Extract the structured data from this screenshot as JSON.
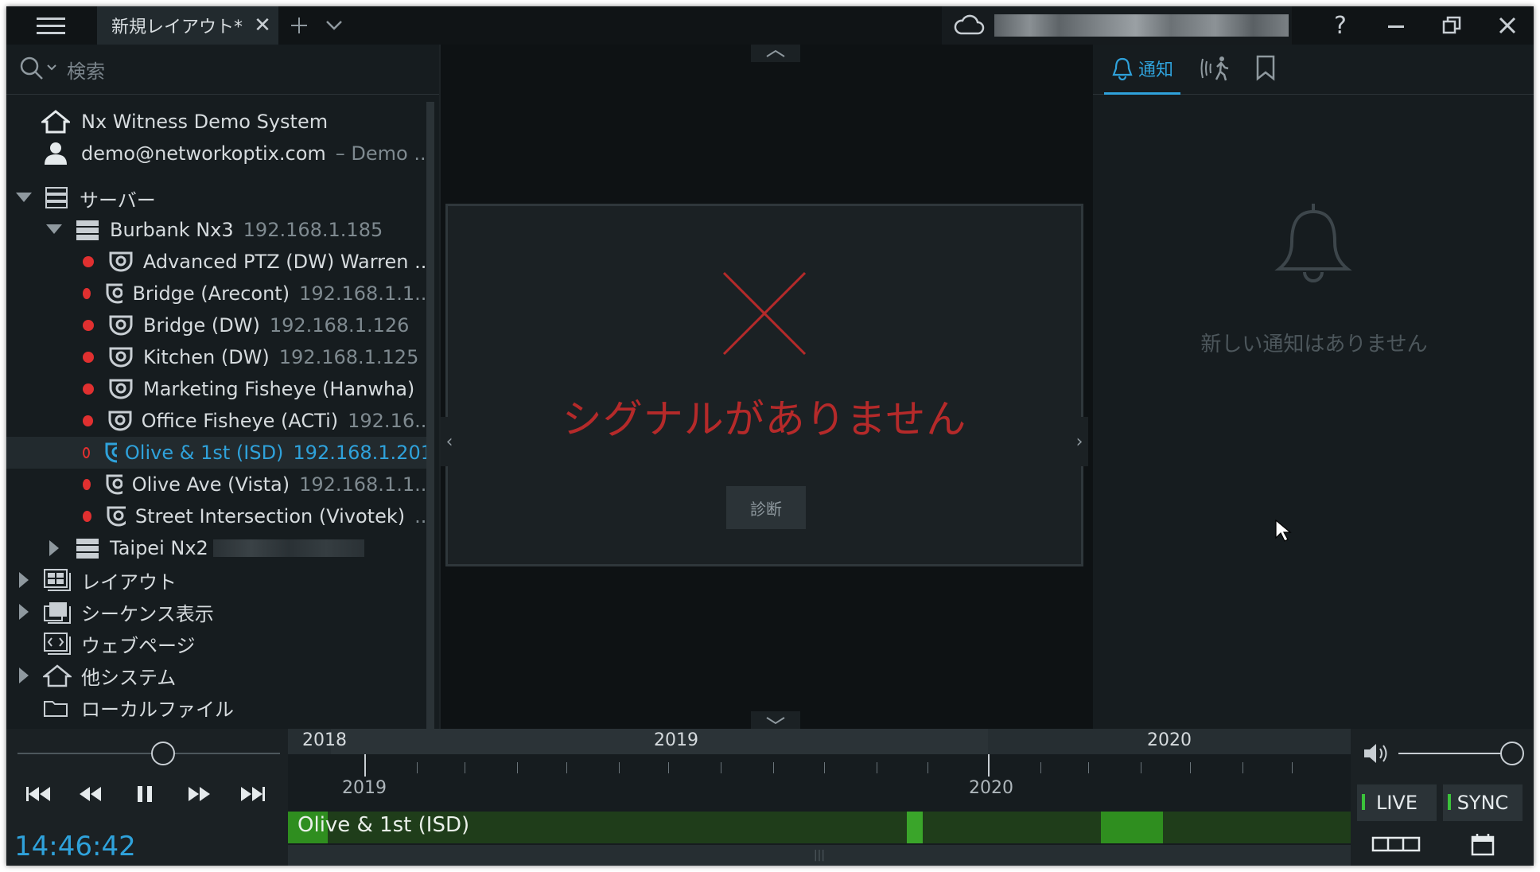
{
  "titlebar": {
    "tab_label": "新規レイアウト*",
    "help_label": "?"
  },
  "search": {
    "placeholder": "検索"
  },
  "tree": {
    "system_name": "Nx Witness Demo System",
    "user_name": "demo@networkoptix.com",
    "user_role": "– Demo ...",
    "servers_label": "サーバー",
    "server1": {
      "name": "Burbank Nx3",
      "ip": "192.168.1.185"
    },
    "cameras": [
      {
        "name": "Advanced PTZ (DW) Warren ...",
        "ip": "",
        "status": "recording"
      },
      {
        "name": "Bridge (Arecont)",
        "ip": "192.168.1.1...",
        "status": "recording"
      },
      {
        "name": "Bridge (DW)",
        "ip": "192.168.1.126",
        "status": "recording"
      },
      {
        "name": "Kitchen (DW)",
        "ip": "192.168.1.125",
        "status": "recording"
      },
      {
        "name": "Marketing Fisheye (Hanwha)",
        "ip": "",
        "status": "recording"
      },
      {
        "name": "Office Fisheye (ACTi)",
        "ip": "192.16...",
        "status": "recording"
      },
      {
        "name": "Olive & 1st (ISD)",
        "ip": "192.168.1.201",
        "status": "offline"
      },
      {
        "name": "Olive Ave (Vista)",
        "ip": "192.168.1.1...",
        "status": "recording"
      },
      {
        "name": "Street Intersection (Vivotek)",
        "ip": "...",
        "status": "recording"
      }
    ],
    "server2": {
      "name": "Taipei Nx2"
    },
    "layouts_label": "レイアウト",
    "showreels_label": "シーケンス表示",
    "webpages_label": "ウェブページ",
    "other_systems_label": "他システム",
    "local_files_label": "ローカルファイル"
  },
  "viewer": {
    "no_signal": "シグナルがありません",
    "diagnostics_label": "診断"
  },
  "notifications": {
    "tab_label": "通知",
    "empty_text": "新しい通知はありません"
  },
  "timeline": {
    "time": "14:46:42",
    "years_top": [
      "2018",
      "2019",
      "2020"
    ],
    "years_bottom": [
      "2019",
      "2020"
    ],
    "camera_label": "Olive & 1st (ISD)",
    "live_label": "LIVE",
    "sync_label": "SYNC",
    "volume_level": 1.0,
    "speed_level": 0.55
  },
  "colors": {
    "accent": "#2fa2db",
    "error": "#b52a2a",
    "recording": "#2f8e1f",
    "status_red": "#e03030"
  }
}
